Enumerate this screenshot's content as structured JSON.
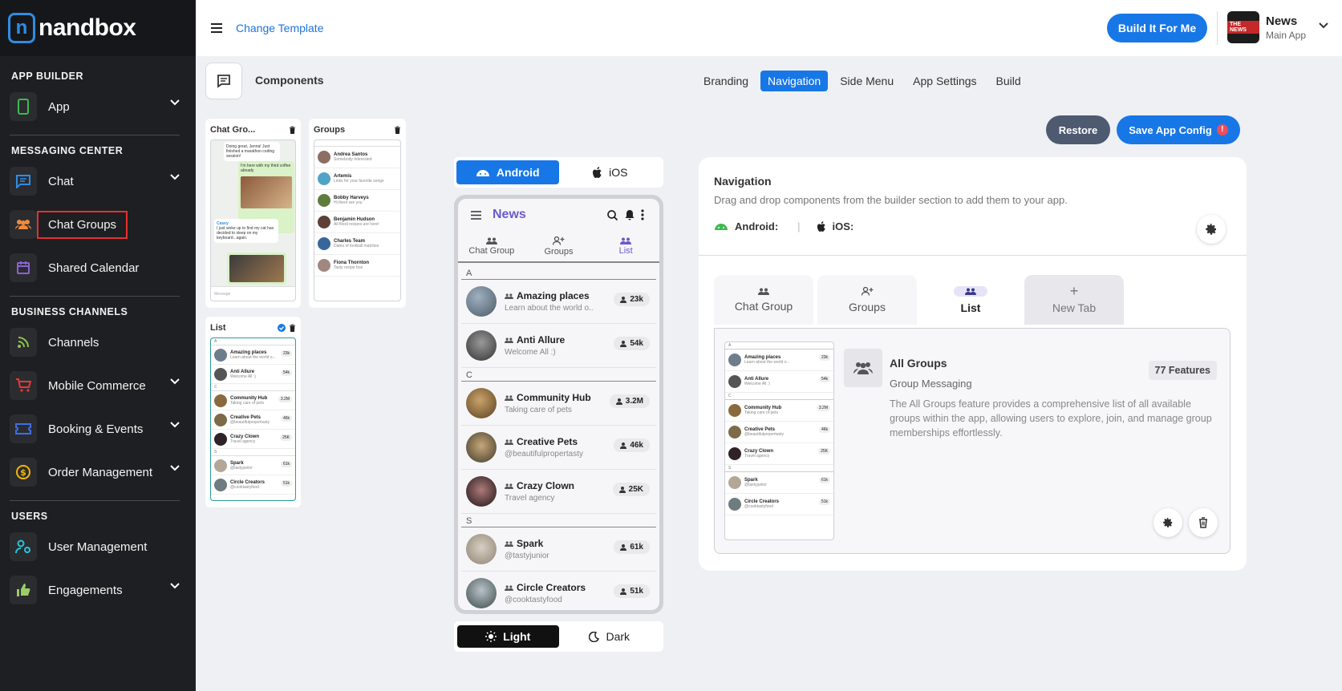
{
  "brand": {
    "logo_text": "nandbox",
    "logo_mark": "n"
  },
  "sidebar": {
    "sections": [
      {
        "title": "APP BUILDER"
      },
      {
        "title": "MESSAGING CENTER"
      },
      {
        "title": "BUSINESS CHANNELS"
      },
      {
        "title": "USERS"
      }
    ],
    "items": [
      {
        "label": "App",
        "icon": "phone-icon",
        "icon_color": "#3fb950"
      },
      {
        "label": "Chat",
        "icon": "chat-icon",
        "icon_color": "#2f8de4"
      },
      {
        "label": "Chat Groups",
        "icon": "group-icon",
        "icon_color": "#f08a3c"
      },
      {
        "label": "Shared Calendar",
        "icon": "calendar-icon",
        "icon_color": "#8a63d2"
      },
      {
        "label": "Channels",
        "icon": "rss-icon",
        "icon_color": "#8bc34a"
      },
      {
        "label": "Mobile Commerce",
        "icon": "cart-icon",
        "icon_color": "#e53935"
      },
      {
        "label": "Booking & Events",
        "icon": "ticket-icon",
        "icon_color": "#3f6ee8"
      },
      {
        "label": "Order Management",
        "icon": "dollar-icon",
        "icon_color": "#f2b705"
      },
      {
        "label": "User Management",
        "icon": "user-gear-icon",
        "icon_color": "#26c6da"
      },
      {
        "label": "Engagements",
        "icon": "thumbs-up-icon",
        "icon_color": "#9ccc65"
      }
    ]
  },
  "topbar": {
    "change_template": "Change Template",
    "build_button": "Build It For Me",
    "app_name": "News",
    "app_subtitle": "Main App",
    "app_thumb_label": "THE NEWS"
  },
  "components": {
    "title": "Components",
    "cards": [
      {
        "title": "Chat Gro..."
      },
      {
        "title": "Groups"
      },
      {
        "title": "List"
      }
    ],
    "chat_preview": {
      "msg1": "Doing great, Jenna! Just finished a marathon coding session!",
      "msg2": "I'm here with my third coffee already",
      "sender": "Casey",
      "msg3": "I just woke up to find my cat has decided to sleep on my keyboard...again.",
      "input_placeholder": "Message"
    },
    "groups_preview": [
      {
        "name": "Andrea Santos",
        "sub": "Somebody Interested"
      },
      {
        "name": "Artemis",
        "sub": "Links for your favorite songs"
      },
      {
        "name": "Bobby Harveys",
        "sub": "Hi there are you"
      },
      {
        "name": "Benjamin Hudson",
        "sub": "All flood recipes are here!"
      },
      {
        "name": "Charles Team",
        "sub": "Dates of football matches"
      },
      {
        "name": "Fiona Thornton",
        "sub": "Tasty recipe box"
      }
    ]
  },
  "tabs": {
    "items": [
      "Branding",
      "Navigation",
      "Side Menu",
      "App Settings",
      "Build"
    ],
    "active": "Navigation"
  },
  "actions": {
    "restore": "Restore",
    "save": "Save App Config",
    "save_warning": "!"
  },
  "phone": {
    "os": {
      "android": "Android",
      "ios": "iOS"
    },
    "title": "News",
    "tabs": [
      "Chat Group",
      "Groups",
      "List"
    ],
    "list": [
      {
        "section": "A"
      },
      {
        "name": "Amazing places",
        "sub": "Learn about the world o...",
        "count": "23k",
        "color": "#6d7d8b"
      },
      {
        "name": "Anti Allure",
        "sub": "Welcome All :)",
        "count": "54k",
        "color": "#555555"
      },
      {
        "section": "C"
      },
      {
        "name": "Community Hub",
        "sub": "Taking care of pets",
        "count": "3.2M",
        "color": "#8a6a3d"
      },
      {
        "name": "Creative Pets",
        "sub": "@beautifulpropertasty",
        "count": "46k",
        "color": "#7d6a48"
      },
      {
        "name": "Crazy Clown",
        "sub": "Travel agency",
        "count": "25K",
        "color": "#2e2326"
      },
      {
        "section": "S"
      },
      {
        "name": "Spark",
        "sub": "@tastyjunior",
        "count": "61k",
        "color": "#b3a898"
      },
      {
        "name": "Circle Creators",
        "sub": "@cooktastyfood",
        "count": "51k",
        "color": "#6e7c80"
      }
    ],
    "theme": {
      "light": "Light",
      "dark": "Dark"
    }
  },
  "navigation_panel": {
    "title": "Navigation",
    "description": "Drag and drop components from the builder section to add them to your app.",
    "android_label": "Android:",
    "ios_label": "iOS:",
    "tabs": [
      "Chat Group",
      "Groups",
      "List",
      "New Tab"
    ],
    "new_tab_symbol": "+",
    "feature": {
      "title": "All Groups",
      "subtitle": "Group Messaging",
      "count": "77 Features",
      "description": "The All Groups feature provides a comprehensive list of all available groups within the app, allowing users to explore, join, and manage group memberships effortlessly."
    }
  }
}
